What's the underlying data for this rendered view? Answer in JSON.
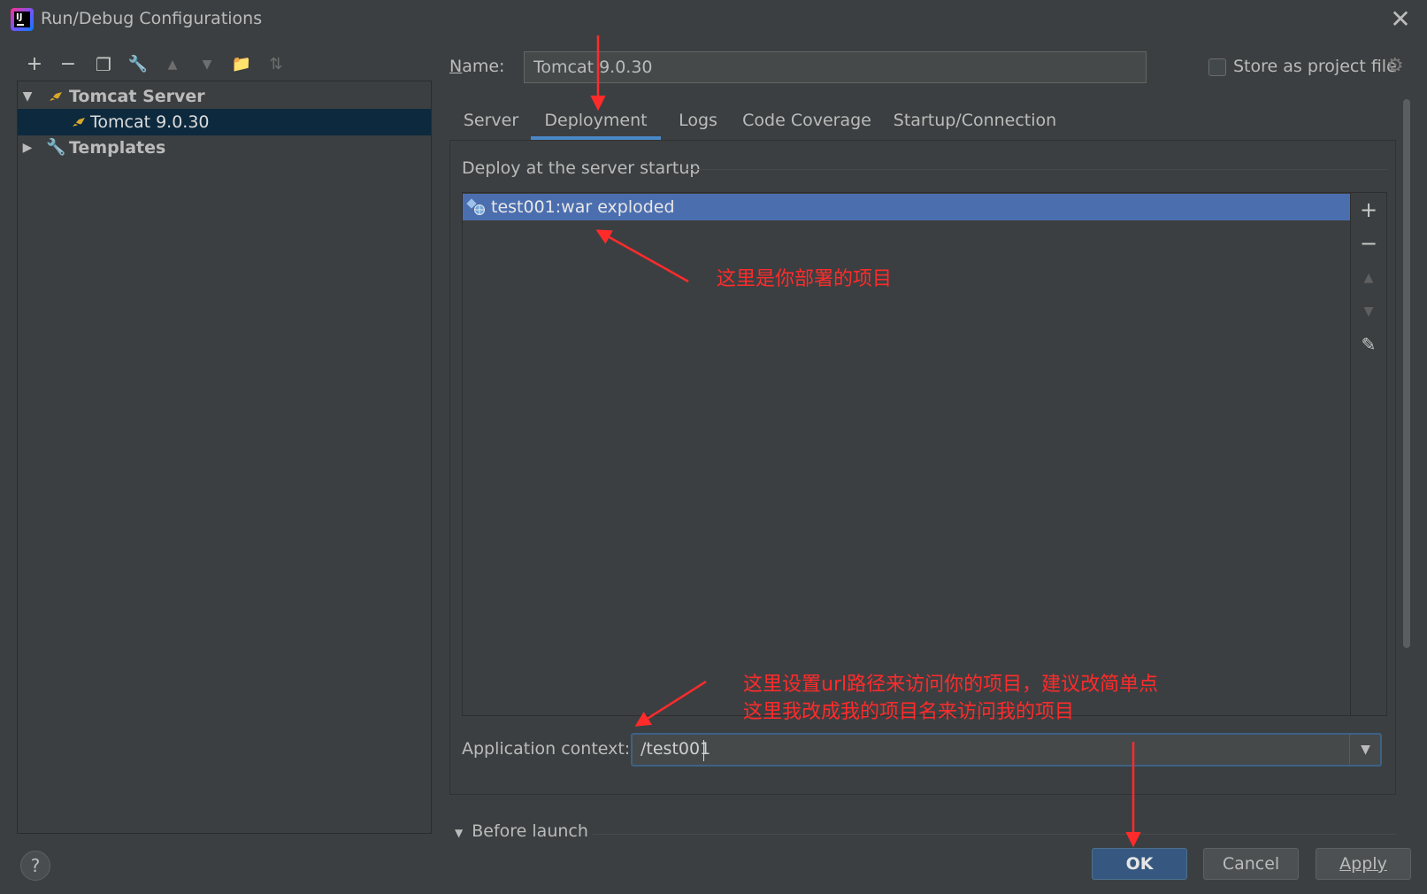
{
  "window": {
    "title": "Run/Debug Configurations",
    "close_glyph": "✕"
  },
  "toolbar": [
    {
      "name": "add-icon",
      "glyph": "+"
    },
    {
      "name": "remove-icon",
      "glyph": "−"
    },
    {
      "name": "copy-icon",
      "glyph": "❐"
    },
    {
      "name": "wrench-icon",
      "glyph": "🔧"
    },
    {
      "name": "move-up-icon",
      "glyph": "▲"
    },
    {
      "name": "move-down-icon",
      "glyph": "▼"
    },
    {
      "name": "folder-add-icon",
      "glyph": "📁"
    },
    {
      "name": "sort-icon",
      "glyph": "⇅"
    }
  ],
  "tree": {
    "group_label": "Tomcat Server",
    "config_label": "Tomcat 9.0.30",
    "templates_label": "Templates"
  },
  "name_field": {
    "label_prefix": "N",
    "label_rest": "ame:",
    "value": "Tomcat 9.0.30"
  },
  "store": {
    "label": "Store as project file",
    "checked": false
  },
  "tabs": [
    {
      "label": "Server",
      "active": false
    },
    {
      "label": "Deployment",
      "active": true
    },
    {
      "label": "Logs",
      "active": false
    },
    {
      "label": "Code Coverage",
      "active": false
    },
    {
      "label": "Startup/Connection",
      "active": false
    }
  ],
  "deployment": {
    "section_title": "Deploy at the server startup",
    "items": [
      "test001:war exploded"
    ],
    "app_context_label": "Application context:",
    "app_context_value": "/test001"
  },
  "before_launch": "Before launch",
  "buttons": {
    "help": "?",
    "ok": "OK",
    "cancel": "Cancel",
    "apply": "Apply"
  },
  "annotations": {
    "note1": "这里是你部署的项目",
    "note2_line1": "这里设置url路径来访问你的项目，建议改简单点",
    "note2_line2": "这里我改成我的项目名来访问我的项目"
  },
  "colors": {
    "selection": "#4b6eaf",
    "tree_selection": "#0d293e",
    "tab_accent": "#4a88c7",
    "annotation": "#ff2b2b",
    "ok_button": "#365880"
  }
}
